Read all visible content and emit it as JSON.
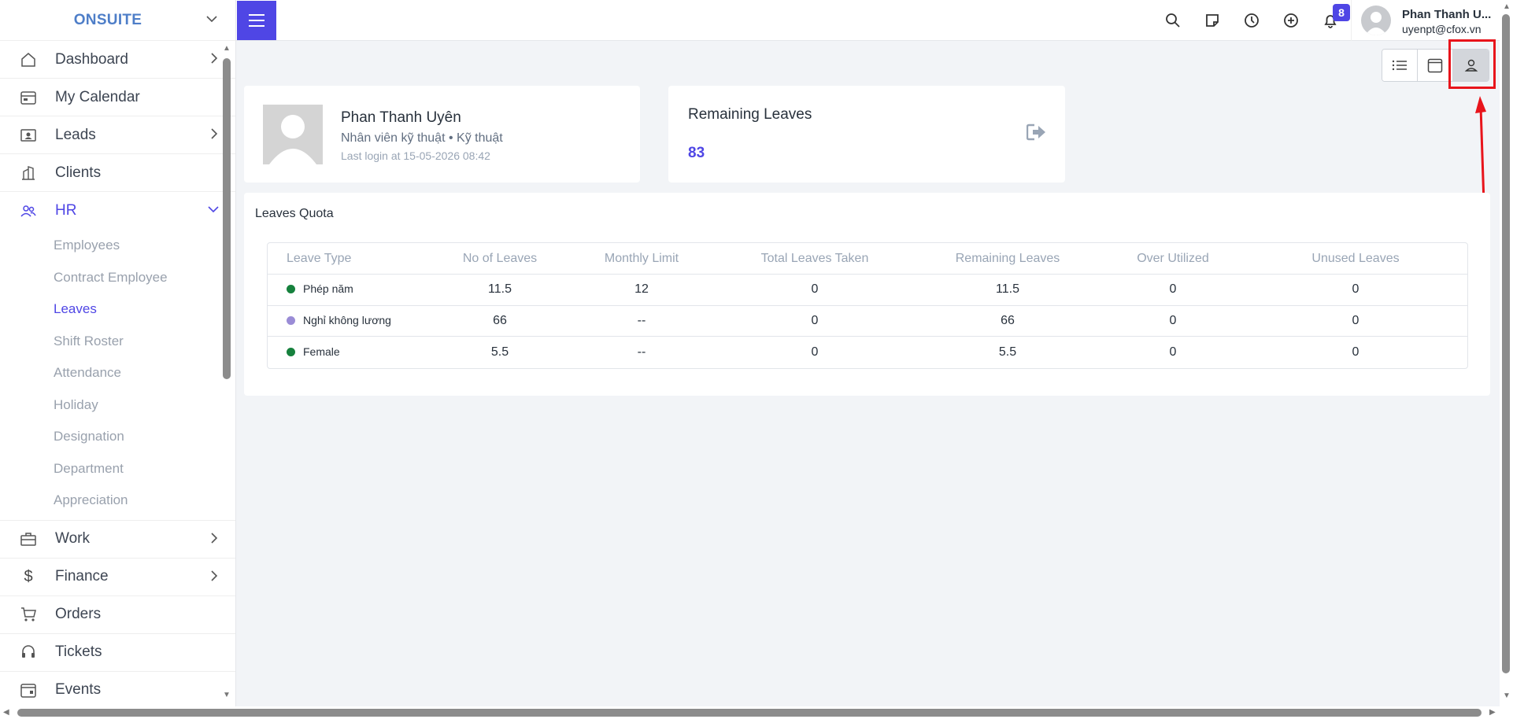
{
  "brand": {
    "name": "ONSUITE"
  },
  "sidebar": {
    "items": [
      {
        "label": "Dashboard",
        "icon": "home-icon",
        "has_chevron": true
      },
      {
        "label": "My Calendar",
        "icon": "calendar-icon",
        "has_chevron": false
      },
      {
        "label": "Leads",
        "icon": "id-card-icon",
        "has_chevron": true
      },
      {
        "label": "Clients",
        "icon": "building-icon",
        "has_chevron": false
      },
      {
        "label": "HR",
        "icon": "people-icon",
        "has_chevron": true,
        "expanded": true
      }
    ],
    "hr_subitems": [
      {
        "label": "Employees"
      },
      {
        "label": "Contract Employee"
      },
      {
        "label": "Leaves",
        "active": true
      },
      {
        "label": "Shift Roster"
      },
      {
        "label": "Attendance"
      },
      {
        "label": "Holiday"
      },
      {
        "label": "Designation"
      },
      {
        "label": "Department"
      },
      {
        "label": "Appreciation"
      }
    ],
    "items_after": [
      {
        "label": "Work",
        "icon": "briefcase-icon",
        "has_chevron": true
      },
      {
        "label": "Finance",
        "icon": "dollar-icon",
        "has_chevron": true
      },
      {
        "label": "Orders",
        "icon": "cart-icon",
        "has_chevron": false
      },
      {
        "label": "Tickets",
        "icon": "headset-icon",
        "has_chevron": false
      },
      {
        "label": "Events",
        "icon": "event-calendar-icon",
        "has_chevron": false
      }
    ]
  },
  "header": {
    "notification_count": "8",
    "user_name": "Phan Thanh U...",
    "user_email": "uyenpt@cfox.vn"
  },
  "profile": {
    "name": "Phan Thanh Uyên",
    "role": "Nhân viên kỹ thuật • Kỹ thuật",
    "last_login": "Last login at 15-05-2026 08:42"
  },
  "remaining": {
    "title": "Remaining Leaves",
    "value": "83"
  },
  "quota": {
    "title": "Leaves Quota",
    "columns": [
      "Leave Type",
      "No of Leaves",
      "Monthly Limit",
      "Total Leaves Taken",
      "Remaining Leaves",
      "Over Utilized",
      "Unused Leaves"
    ],
    "rows": [
      {
        "type": "Phép năm",
        "color": "#16813d",
        "no": "11.5",
        "monthly": "12",
        "taken": "0",
        "remaining": "11.5",
        "over": "0",
        "unused": "0"
      },
      {
        "type": "Nghỉ không lương",
        "color": "#9a8cd6",
        "no": "66",
        "monthly": "--",
        "taken": "0",
        "remaining": "66",
        "over": "0",
        "unused": "0"
      },
      {
        "type": "Female",
        "color": "#16813d",
        "no": "5.5",
        "monthly": "--",
        "taken": "0",
        "remaining": "5.5",
        "over": "0",
        "unused": "0"
      }
    ]
  },
  "colors": {
    "accent": "#4f46e5",
    "highlight": "#e8141b"
  }
}
